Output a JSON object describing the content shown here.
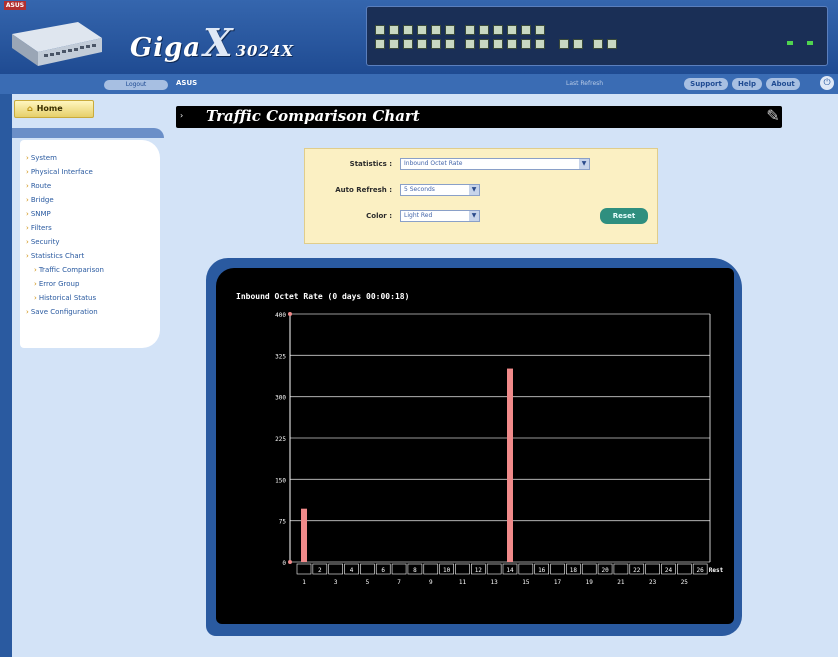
{
  "header": {
    "brand_logo": "ASUS",
    "product_name": "Giga",
    "product_x": "X",
    "model": "3024X",
    "switch_label": "GigaX Switch 3024X"
  },
  "topbar": {
    "logout_label": "Logout",
    "user_label": "ASUS",
    "last_refresh": "Last Refresh",
    "buttons": [
      "Support",
      "Help",
      "About"
    ]
  },
  "sidebar": {
    "home_label": "Home",
    "items": [
      {
        "label": "System"
      },
      {
        "label": "Physical Interface"
      },
      {
        "label": "Route"
      },
      {
        "label": "Bridge"
      },
      {
        "label": "SNMP"
      },
      {
        "label": "Filters"
      },
      {
        "label": "Security"
      },
      {
        "label": "Statistics Chart"
      },
      {
        "label": "Traffic Comparison",
        "sub": true
      },
      {
        "label": "Error Group",
        "sub": true
      },
      {
        "label": "Historical Status",
        "sub": true
      },
      {
        "label": "Save Configuration"
      }
    ]
  },
  "page": {
    "title": "Traffic Comparison Chart"
  },
  "controls": {
    "statistics_label": "Statistics :",
    "statistics_value": "Inbound Octet Rate",
    "auto_refresh_label": "Auto Refresh :",
    "auto_refresh_value": "5 Seconds",
    "color_label": "Color :",
    "color_value": "Light Red",
    "reset_label": "Reset"
  },
  "colors": {
    "bar": "#f08a8a",
    "chart_bg": "#000000",
    "grid": "#ffffff"
  },
  "chart_data": {
    "type": "bar",
    "title": "Inbound Octet Rate (0 days 00:00:18)",
    "ylim": [
      0,
      400
    ],
    "yticks": [
      0,
      75,
      150,
      225,
      300,
      325,
      400
    ],
    "ytick_labels": [
      "0",
      "75",
      "150",
      "225",
      "300",
      "325",
      "400"
    ],
    "categories": [
      "1",
      "2",
      "3",
      "4",
      "5",
      "6",
      "7",
      "8",
      "9",
      "10",
      "11",
      "12",
      "13",
      "14",
      "15",
      "16",
      "17",
      "18",
      "19",
      "20",
      "21",
      "22",
      "23",
      "24",
      "25",
      "26",
      "Rest"
    ],
    "values": [
      86,
      0,
      0,
      0,
      0,
      0,
      0,
      0,
      0,
      0,
      0,
      0,
      0,
      312,
      0,
      0,
      0,
      0,
      0,
      0,
      0,
      0,
      0,
      0,
      0,
      0,
      0
    ]
  }
}
